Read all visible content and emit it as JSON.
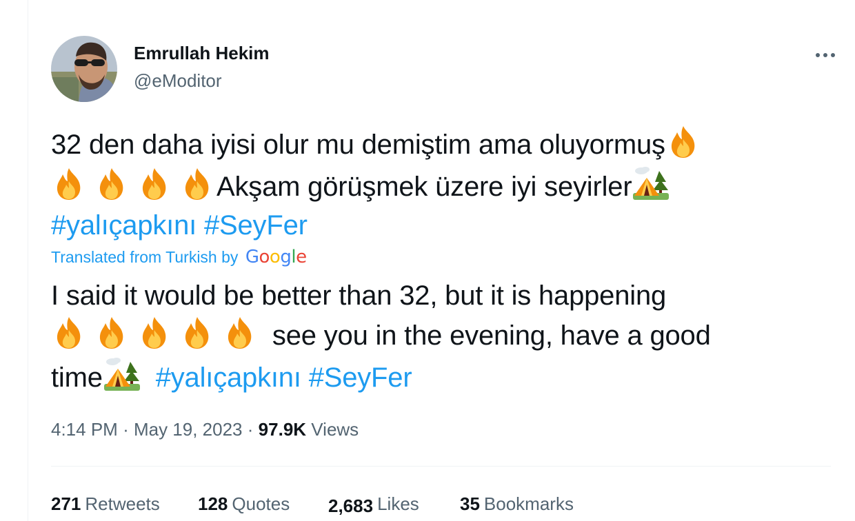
{
  "tweet": {
    "author": {
      "name": "Emrullah Hekim",
      "handle": "@eModitor"
    },
    "original_text": {
      "line1": "32 den daha iyisi olur mu demiştim ama oluyormuş",
      "line2": "Akşam görüşmek üzere iyi seyirler",
      "hashtag1": "#yalıçapkını",
      "hashtag2": "#SeyFer"
    },
    "translation_label": "Translated from Turkish by",
    "translation_provider": "Google",
    "translated_text": {
      "line1": "I said it would be better than 32, but it is happening",
      "line2": "see you in the evening, have a good",
      "line3": "time",
      "hashtag1": "#yalıçapkını",
      "hashtag2": "#SeyFer"
    },
    "meta": {
      "time": "4:14 PM",
      "separator": "·",
      "date": "May 19, 2023",
      "views_count": "97.9K",
      "views_label": "Views"
    },
    "stats": {
      "retweets_count": "271",
      "retweets_label": "Retweets",
      "quotes_count": "128",
      "quotes_label": "Quotes",
      "likes_count": "2,683",
      "likes_label": "Likes",
      "bookmarks_count": "35",
      "bookmarks_label": "Bookmarks"
    },
    "icons": {
      "fire": "fire-emoji-icon",
      "camping": "camping-emoji-icon",
      "more": "more-options-icon"
    },
    "colors": {
      "link": "#1d9bf0",
      "secondary": "#536471",
      "primary": "#0f1419",
      "divider": "#eff3f4"
    }
  }
}
